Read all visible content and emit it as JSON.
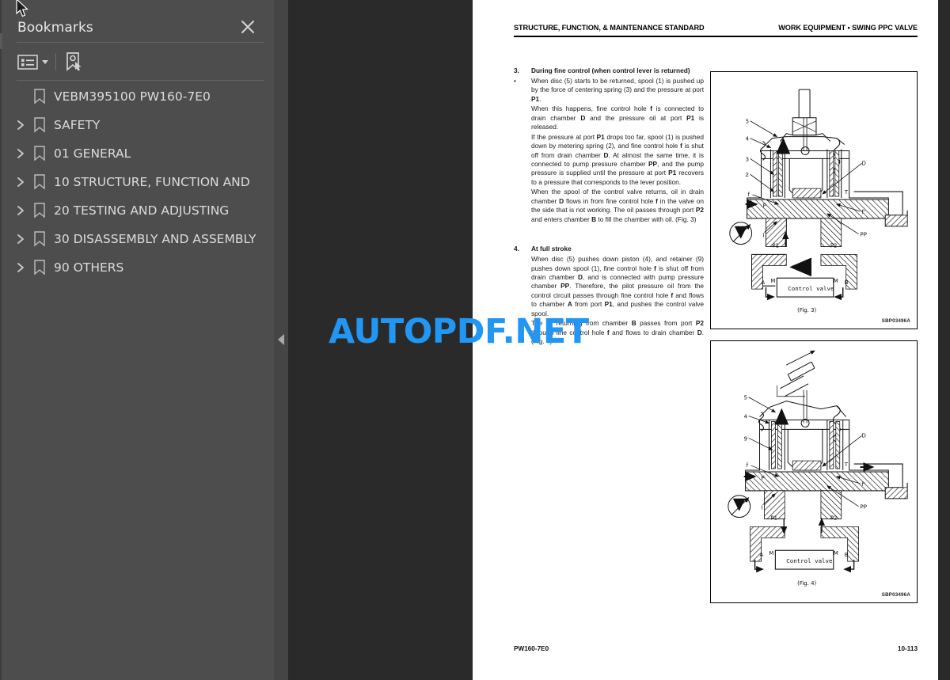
{
  "app": {
    "background_color": "#2a2a2a",
    "sidebar_color": "#4d4d4d",
    "accent_color": "#2196f3"
  },
  "sidebar": {
    "title": "Bookmarks",
    "close_label": "Close",
    "toolbar": [
      {
        "name": "bookmark-options-icon",
        "label": "Options"
      },
      {
        "name": "new-bookmark-icon",
        "label": "New Bookmark"
      }
    ],
    "items": [
      {
        "label": "VEBM395100 PW160-7E0",
        "expandable": false
      },
      {
        "label": "SAFETY",
        "expandable": true
      },
      {
        "label": "01 GENERAL",
        "expandable": true
      },
      {
        "label": "10 STRUCTURE, FUNCTION AND",
        "expandable": true
      },
      {
        "label": "20 TESTING AND ADJUSTING",
        "expandable": true
      },
      {
        "label": "30 DISASSEMBLY AND ASSEMBLY",
        "expandable": true
      },
      {
        "label": "90 OTHERS",
        "expandable": true
      }
    ]
  },
  "viewer": {
    "collapse_handle_label": "Collapse panel",
    "watermark": "AUTOPDF.NET"
  },
  "document": {
    "header_left": "STRUCTURE, FUNCTION, & MAINTENANCE STANDARD",
    "header_right": "WORK EQUIPMENT • SWING PPC VALVE",
    "footer_left": "PW160-7E0",
    "footer_right": "10-113",
    "sections": [
      {
        "number": "3.",
        "title": "During fine control (when control lever is returned)",
        "bullet": "•",
        "paragraphs": [
          "When disc (5) starts to be returned, spool (1) is pushed up by the force of centering spring (3) and the pressure at port P1.",
          "When this happens, fine control hole f is connected to drain chamber D and the pressure oil at port P1 is released.",
          "If the pressure at port P1 drops too far, spool (1) is pushed down by metering spring (2), and fine control hole f is shut off from drain chamber D. At almost the same time, it is connected to pump pressure chamber PP, and the pump pressure is supplied until the pressure at port P1 recovers to a pressure that corresponds to the lever position.",
          "When the spool of the control valve returns, oil in drain chamber D flows in from fine control hole f in the valve on the side that is not working. The oil passes through port P2 and enters chamber B to fill the chamber with oil. (Fig. 3)"
        ]
      },
      {
        "number": "4.",
        "title": "At full stroke",
        "bullet": "",
        "paragraphs": [
          "When disc (5) pushes down piston (4), and retainer (9) pushes down spool (1), fine control hole f is shut off from drain chamber D, and is connected with pump pressure chamber PP. Therefore, the pilot pressure oil from the control circuit passes through fine control hole f and flows to chamber A from port P1, and pushes the control valve spool.",
          "The oil returning from chamber B passes from port P2 through fine control hole f and flows to drain chamber D. (Fig. 4)"
        ]
      }
    ],
    "figures": [
      {
        "caption": "(Fig. 3)",
        "code": "SBP03496A",
        "control_valve_label": "Control valve",
        "callouts": [
          "5",
          "4",
          "3",
          "2",
          "f",
          "P",
          "I",
          "P1",
          "P2",
          "D",
          "T",
          "f'",
          "PP",
          "A",
          "M",
          "M",
          "B"
        ]
      },
      {
        "caption": "(Fig. 4)",
        "code": "SBP03496A",
        "control_valve_label": "Control valve",
        "callouts": [
          "5",
          "4",
          "9",
          "f",
          "P",
          "I",
          "P1",
          "P2",
          "D",
          "T",
          "f'",
          "PP",
          "A",
          "M",
          "M",
          "B"
        ]
      }
    ]
  }
}
